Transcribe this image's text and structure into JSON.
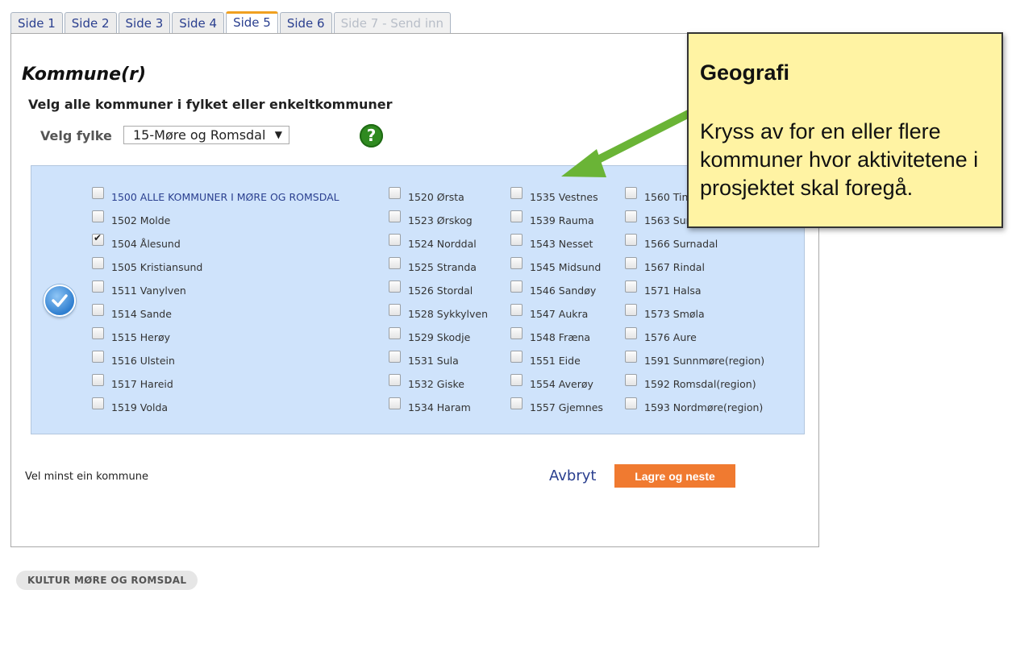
{
  "tabs": [
    {
      "label": "Side 1",
      "state": "normal"
    },
    {
      "label": "Side 2",
      "state": "normal"
    },
    {
      "label": "Side 3",
      "state": "normal"
    },
    {
      "label": "Side 4",
      "state": "normal"
    },
    {
      "label": "Side 5",
      "state": "active"
    },
    {
      "label": "Side 6",
      "state": "normal"
    },
    {
      "label": "Side 7 - Send inn",
      "state": "disabled"
    }
  ],
  "form": {
    "heading": "Kommune(r)",
    "subheading": "Velg alle kommuner i fylket eller enkeltkommuner",
    "fylke_label": "Velg fylke",
    "fylke_selected": "15-Møre og Romsdal",
    "help_glyph": "?",
    "validation_message": "Vel minst ein kommune",
    "cancel_label": "Avbryt",
    "save_label": "Lagre og neste"
  },
  "kommuner": {
    "col1": [
      {
        "label": "1500 ALLE KOMMUNER I MØRE OG ROMSDAL",
        "checked": false,
        "all": true
      },
      {
        "label": "1502 Molde",
        "checked": false
      },
      {
        "label": "1504 Ålesund",
        "checked": true
      },
      {
        "label": "1505 Kristiansund",
        "checked": false
      },
      {
        "label": "1511 Vanylven",
        "checked": false
      },
      {
        "label": "1514 Sande",
        "checked": false
      },
      {
        "label": "1515 Herøy",
        "checked": false
      },
      {
        "label": "1516 Ulstein",
        "checked": false
      },
      {
        "label": "1517 Hareid",
        "checked": false
      },
      {
        "label": "1519 Volda",
        "checked": false
      }
    ],
    "col2": [
      {
        "label": "1520 Ørsta",
        "checked": false
      },
      {
        "label": "1523 Ørskog",
        "checked": false
      },
      {
        "label": "1524 Norddal",
        "checked": false
      },
      {
        "label": "1525 Stranda",
        "checked": false
      },
      {
        "label": "1526 Stordal",
        "checked": false
      },
      {
        "label": "1528 Sykkylven",
        "checked": false
      },
      {
        "label": "1529 Skodje",
        "checked": false
      },
      {
        "label": "1531 Sula",
        "checked": false
      },
      {
        "label": "1532 Giske",
        "checked": false
      },
      {
        "label": "1534 Haram",
        "checked": false
      }
    ],
    "col3": [
      {
        "label": "1535 Vestnes",
        "checked": false
      },
      {
        "label": "1539 Rauma",
        "checked": false
      },
      {
        "label": "1543 Nesset",
        "checked": false
      },
      {
        "label": "1545 Midsund",
        "checked": false
      },
      {
        "label": "1546 Sandøy",
        "checked": false
      },
      {
        "label": "1547 Aukra",
        "checked": false
      },
      {
        "label": "1548 Fræna",
        "checked": false
      },
      {
        "label": "1551 Eide",
        "checked": false
      },
      {
        "label": "1554 Averøy",
        "checked": false
      },
      {
        "label": "1557 Gjemnes",
        "checked": false
      }
    ],
    "col4": [
      {
        "label": "1560 Tin",
        "checked": false
      },
      {
        "label": "1563 Sun",
        "checked": false
      },
      {
        "label": "1566 Surnadal",
        "checked": false
      },
      {
        "label": "1567 Rindal",
        "checked": false
      },
      {
        "label": "1571 Halsa",
        "checked": false
      },
      {
        "label": "1573 Smøla",
        "checked": false
      },
      {
        "label": "1576 Aure",
        "checked": false
      },
      {
        "label": "1591 Sunnmøre(region)",
        "checked": false
      },
      {
        "label": "1592 Romsdal(region)",
        "checked": false
      },
      {
        "label": "1593 Nordmøre(region)",
        "checked": false
      }
    ]
  },
  "footer": {
    "badge": "KULTUR MØRE OG ROMSDAL"
  },
  "callout": {
    "title": "Geografi",
    "text": "Kryss av for en eller flere kommuner hvor aktivitetene i prosjektet skal foregå.",
    "background": "#fff3a3",
    "arrow_color": "#6ab436"
  },
  "colors": {
    "accent_orange": "#f07a30",
    "panel_blue": "#cfe3fb",
    "link_blue": "#2a3f8f"
  }
}
